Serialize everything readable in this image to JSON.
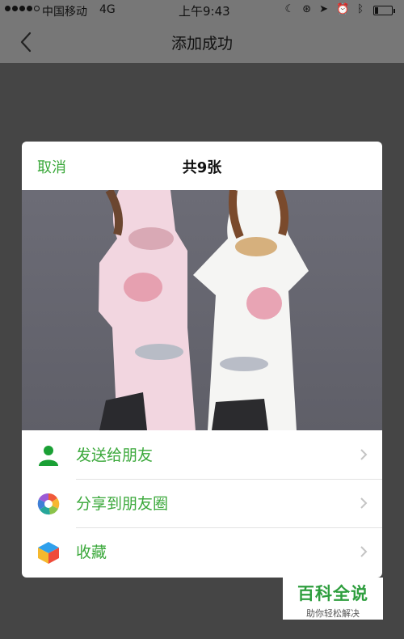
{
  "status_bar": {
    "carrier": "中国移动",
    "network": "4G",
    "time": "上午9:43",
    "signal_bars_filled": 4,
    "battery_level": 0.2
  },
  "nav": {
    "title": "添加成功",
    "back_icon": "chevron-left-icon"
  },
  "dialog": {
    "cancel_label": "取消",
    "count_label": "共9张"
  },
  "menu": {
    "items": [
      {
        "label": "发送给朋友",
        "icon": "person-icon"
      },
      {
        "label": "分享到朋友圈",
        "icon": "moments-icon"
      },
      {
        "label": "收藏",
        "icon": "favorites-cube-icon"
      }
    ]
  },
  "watermark": {
    "title": "百科全说",
    "subtitle": "助你轻松解决"
  },
  "colors": {
    "accent_green": "#3aa83a",
    "overlay": "#454545",
    "header_dimmed": "#777777"
  }
}
